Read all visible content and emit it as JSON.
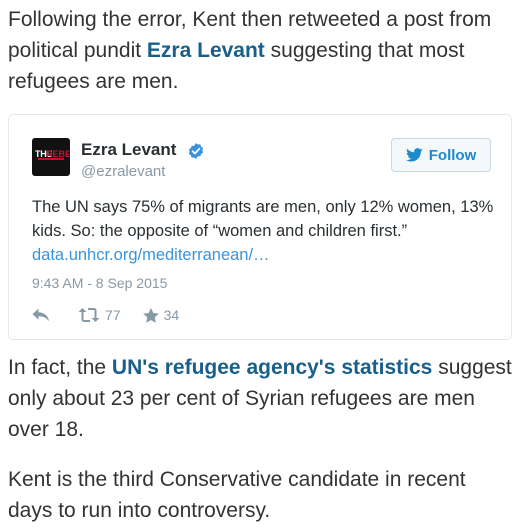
{
  "article": {
    "p1_text_a": "Following the error, Kent then retweeted a post from political pundit ",
    "p1_link": "Ezra Levant",
    "p1_text_b": " suggesting that most refugees are men.",
    "p2_text_a": "In fact, the ",
    "p2_link": "UN's refugee agency's statistics",
    "p2_text_b": " suggest only about 23 per cent of Syrian refugees are men over 18.",
    "p3_text": "Kent is the third Conservative candidate in recent days to run into controversy."
  },
  "tweet": {
    "author_name": "Ezra Levant",
    "handle": "@ezralevant",
    "verified_icon": "verified-badge-icon",
    "avatar_text": "THE REBEL",
    "follow_label": "Follow",
    "follow_icon": "twitter-bird-icon",
    "text": "The UN says 75% of migrants are men, only 12% women, 13% kids. So: the opposite of “women and children first.”",
    "link": "data.unhcr.org/mediterranean/…",
    "timestamp": "9:43 AM - 8 Sep 2015",
    "reply_icon": "reply-icon",
    "retweet_icon": "retweet-icon",
    "retweet_count": "77",
    "like_icon": "star-icon",
    "like_count": "34"
  },
  "colors": {
    "link": "#1a5e8a",
    "twitter_blue": "#1d8acb",
    "verified": "#3b94d9",
    "muted": "#8899a6"
  }
}
